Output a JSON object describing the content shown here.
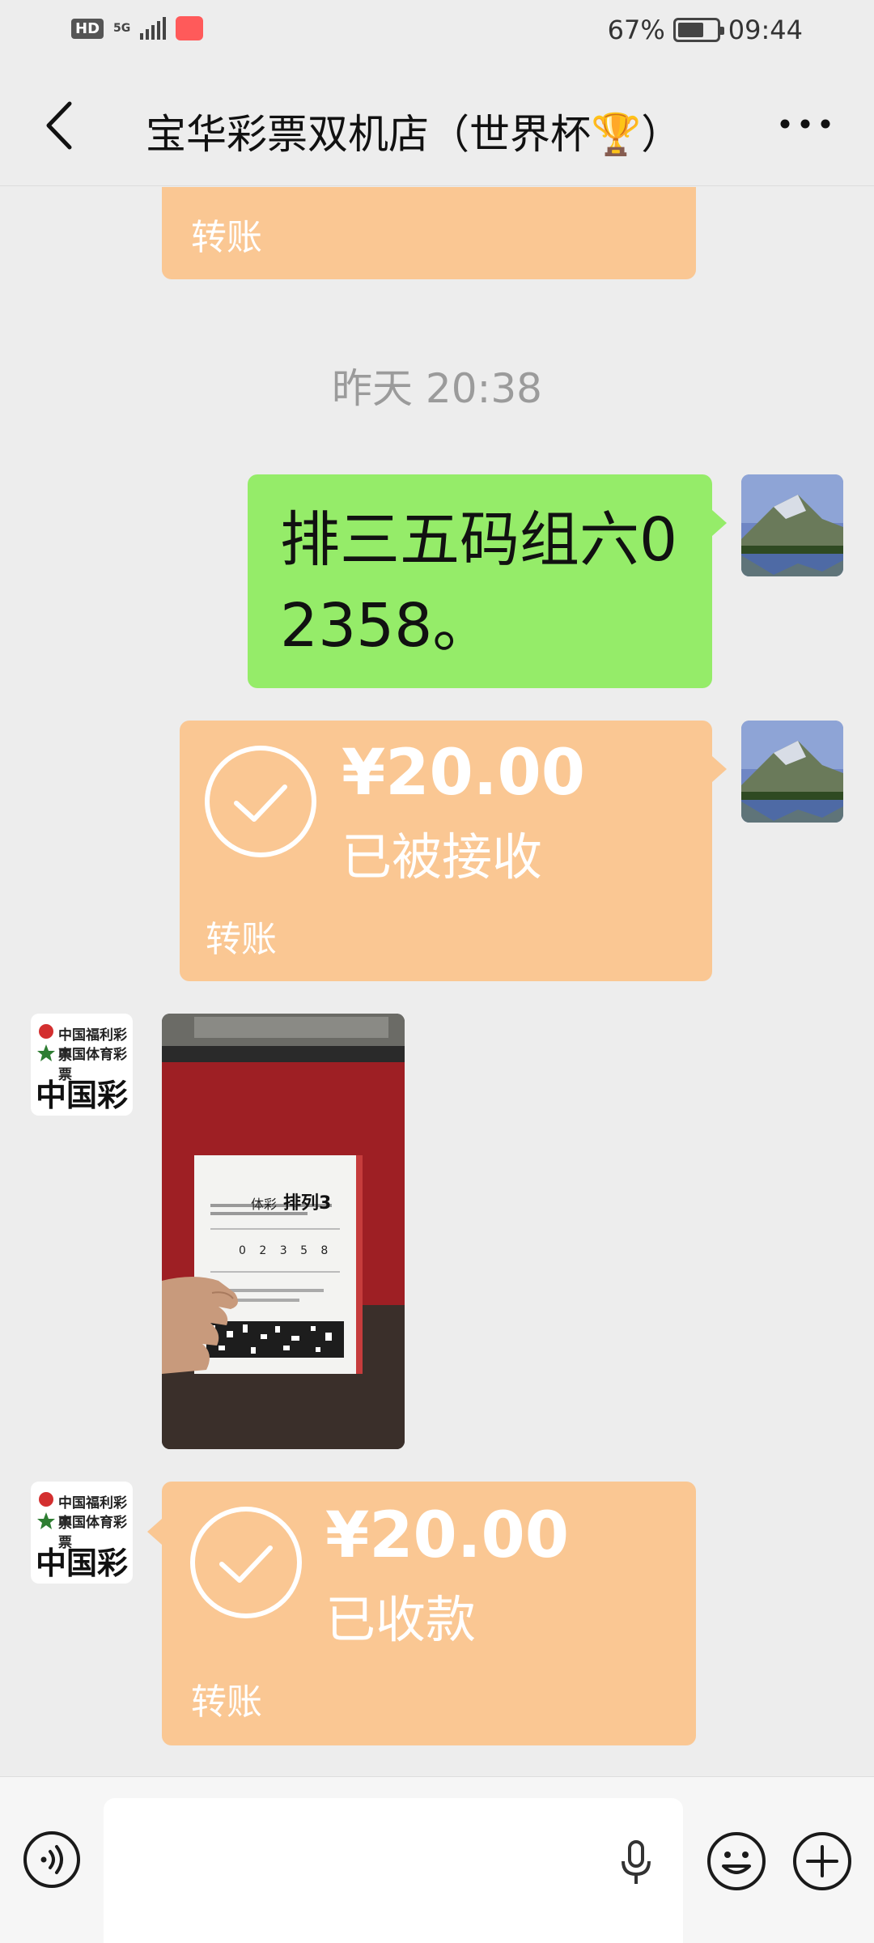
{
  "status_bar": {
    "hd": "HD",
    "network": "5G",
    "battery": "67%",
    "battery_level": 0.67,
    "time": "09:44"
  },
  "nav": {
    "title": "宝华彩票双机店（世界杯🏆）"
  },
  "messages": {
    "partial_transfer_label": "转账",
    "time_separator": "昨天 20:38",
    "outgoing_text": "排三五码组六02358。",
    "outgoing_transfer": {
      "amount": "¥20.00",
      "status": "已被接收",
      "label": "转账"
    },
    "incoming_transfer": {
      "amount": "¥20.00",
      "status": "已收款",
      "label": "转账"
    },
    "lottery_avatar": {
      "line1": "中国福利彩票",
      "line2": "中国体育彩票",
      "big": "中国彩票"
    },
    "ticket": {
      "title_small": "体彩",
      "title": "排列3",
      "numbers": "0 2 3 5 8"
    }
  },
  "colors": {
    "transfer_bubble": "#fac793",
    "text_bubble": "#95ec69",
    "background": "#ededed"
  },
  "icons": [
    "back-icon",
    "more-icon",
    "voice-icon",
    "mic-icon",
    "emoji-icon",
    "plus-icon",
    "check-icon"
  ]
}
